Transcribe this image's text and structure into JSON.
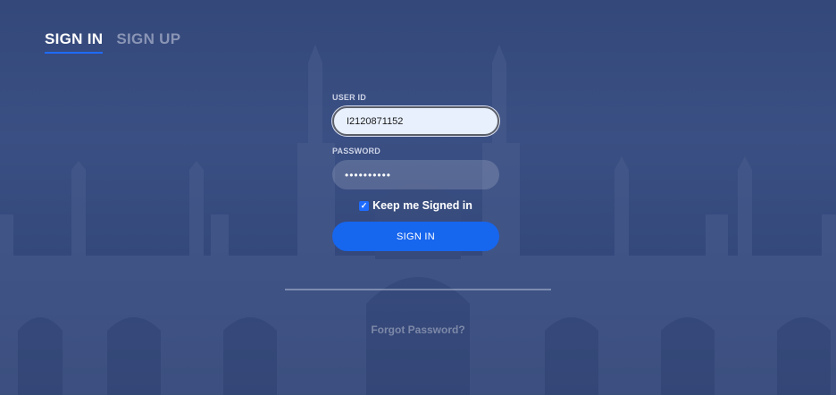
{
  "tabs": {
    "sign_in": "SIGN IN",
    "sign_up": "SIGN UP"
  },
  "form": {
    "user_id_label": "USER ID",
    "user_id_value": "I2120871152",
    "password_label": "PASSWORD",
    "password_value": "••••••••••",
    "keep_signed_in_label": "Keep me Signed in",
    "keep_signed_in_checked": true,
    "sign_in_button": "SIGN IN",
    "forgot_password": "Forgot Password?"
  },
  "colors": {
    "background": "#34487a",
    "accent": "#1766ee",
    "input_focus_bg": "#e8f0fe",
    "muted_text": "#8a95b5"
  },
  "icons": {
    "checkbox": "checkmark-icon"
  }
}
